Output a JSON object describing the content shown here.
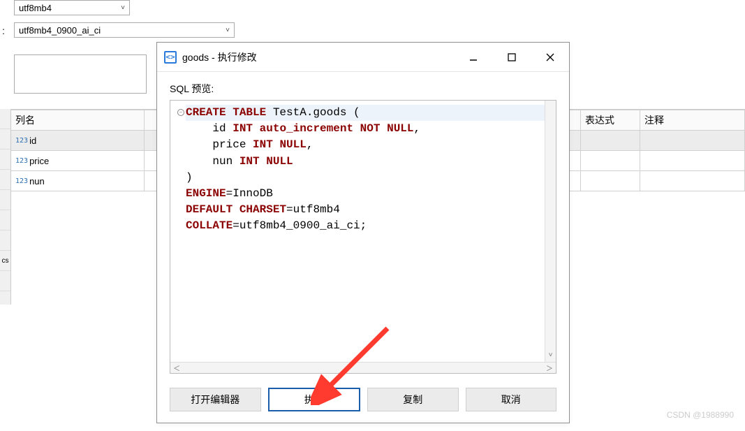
{
  "top_combo1": "utf8mb4",
  "top_combo2_label": ":",
  "top_combo2": "utf8mb4_0900_ai_ci",
  "table": {
    "headers": [
      "列名",
      "",
      "表达式",
      "注释"
    ],
    "rows": [
      {
        "type_badge": "123",
        "name": "id",
        "selected": true
      },
      {
        "type_badge": "123",
        "name": "price",
        "selected": false
      },
      {
        "type_badge": "123",
        "name": "nun",
        "selected": false
      }
    ],
    "side_label": "cs"
  },
  "dialog": {
    "title": "goods - 执行修改",
    "preview_label": "SQL 预览:",
    "sql": {
      "line1": {
        "pre": "CREATE",
        "mid": " TABLE",
        "rest": " TestA.goods ("
      },
      "line2": {
        "id1": "    id ",
        "kw1": "INT",
        "sp1": " ",
        "kw2": "auto_increment",
        "sp2": " ",
        "kw3": "NOT",
        "sp3": " ",
        "kw4": "NULL",
        "tail": ","
      },
      "line3": {
        "id1": "    price ",
        "kw1": "INT",
        "sp1": " ",
        "kw2": "NULL",
        "tail": ","
      },
      "line4": {
        "id1": "    nun ",
        "kw1": "INT",
        "sp1": " ",
        "kw2": "NULL"
      },
      "line5": ")",
      "line6": {
        "kw": "ENGINE",
        "rest": "=InnoDB"
      },
      "line7": {
        "kw1": "DEFAULT",
        "sp": " ",
        "kw2": "CHARSET",
        "rest": "=utf8mb4"
      },
      "line8": {
        "kw": "COLLATE",
        "rest": "=utf8mb4_0900_ai_ci;"
      }
    },
    "buttons": {
      "open_editor": "打开编辑器",
      "execute": "执行",
      "copy": "复制",
      "cancel": "取消"
    }
  },
  "watermark": "CSDN @1988990"
}
